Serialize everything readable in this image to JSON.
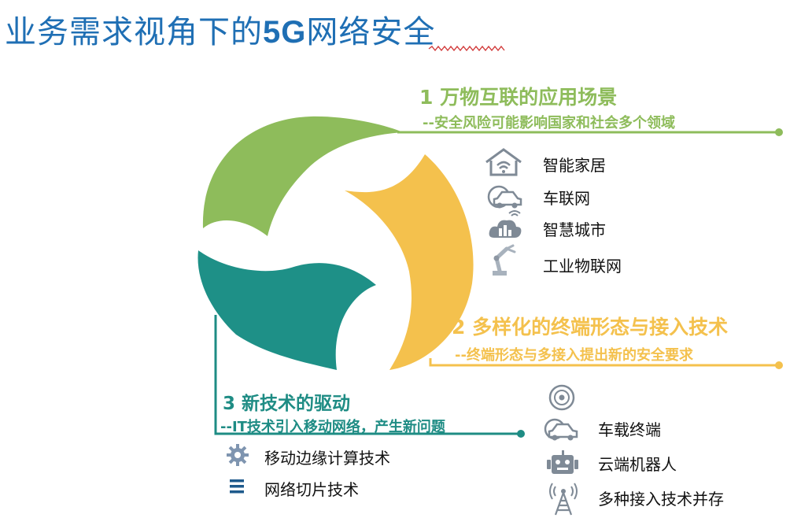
{
  "title": {
    "prefix": "业务需求视角下的",
    "highlight": "5G",
    "suffix": "网络安全"
  },
  "section1": {
    "heading": "1 万物互联的应用场景",
    "subheading": "--安全风险可能影响国家和社会多个领域",
    "items": [
      "智能家居",
      "车联网",
      "智慧城市",
      "工业物联网"
    ]
  },
  "section2": {
    "heading": "2 多样化的终端形态与接入技术",
    "subheading": "--终端形态与多接入提出新的安全要求",
    "items": [
      "车载终端",
      "云端机器人",
      "多种接入技术并存"
    ]
  },
  "section3": {
    "heading": "3 新技术的驱动",
    "subheading": "--IT技术引入移动网络，产生新问题",
    "items": [
      "移动边缘计算技术",
      "网络切片技术"
    ]
  },
  "colors": {
    "title": "#1f6fb4",
    "green": "#8ebc5b",
    "yellow": "#f4c14d",
    "teal": "#1e8c84",
    "icon": "#7f8a96"
  },
  "icons": [
    "smart-home-icon",
    "car-network-icon",
    "cloud-city-icon",
    "robot-arm-icon",
    "disc-icon",
    "car-icon",
    "robot-icon",
    "antenna-tower-icon",
    "gear-icon",
    "menu-lines-icon"
  ]
}
